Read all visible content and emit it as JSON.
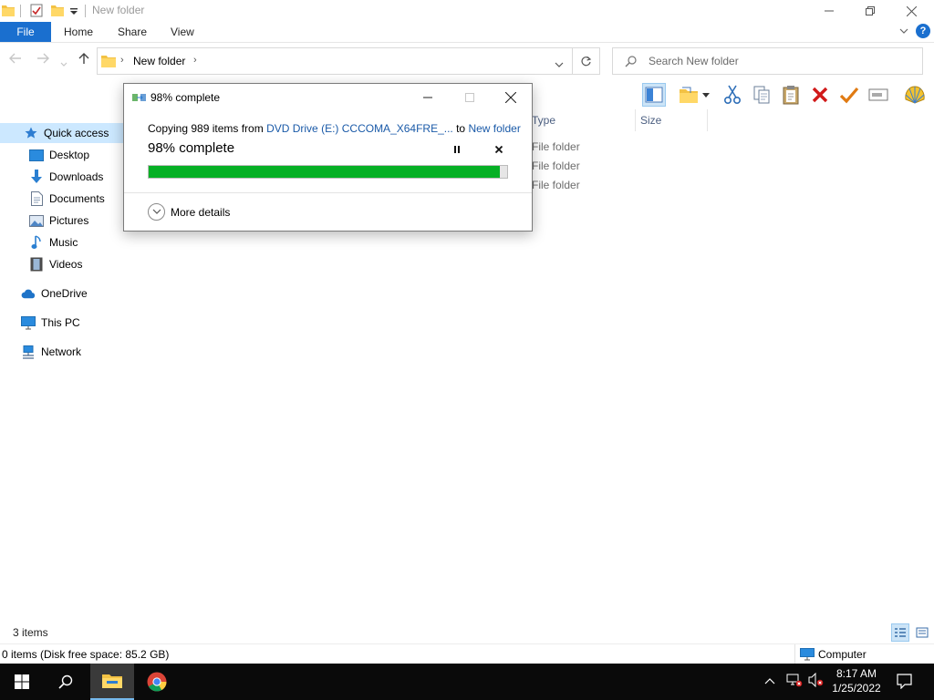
{
  "window": {
    "title": "New folder"
  },
  "ribbon": {
    "tabs": [
      "File",
      "Home",
      "Share",
      "View"
    ]
  },
  "address": {
    "path_segment": "New folder",
    "search_placeholder": "Search New folder"
  },
  "nav_pane": {
    "items": [
      "Quick access",
      "Desktop",
      "Downloads",
      "Documents",
      "Pictures",
      "Music",
      "Videos",
      "OneDrive",
      "This PC",
      "Network"
    ]
  },
  "content": {
    "columns": [
      "Type",
      "Size"
    ],
    "rows": [
      {
        "type": "File folder"
      },
      {
        "type": "File folder"
      },
      {
        "type": "File folder"
      }
    ]
  },
  "status": {
    "items_count": "3 items",
    "details": "0 items (Disk free space: 85.2 GB)",
    "location": "Computer"
  },
  "dialog": {
    "title": "98% complete",
    "copy_prefix": "Copying 989 items from ",
    "source": "DVD Drive (E:) CCCOMA_X64FRE_...",
    "to_word": " to ",
    "destination": "New folder",
    "percent_text": "98% complete",
    "progress_fraction": 0.98,
    "more_details": "More details"
  },
  "taskbar": {
    "time": "8:17 AM",
    "date": "1/25/2022"
  },
  "colors": {
    "accent": "#1a6fcf",
    "progress": "#06b025",
    "taskbar": "#0a0a0a"
  }
}
